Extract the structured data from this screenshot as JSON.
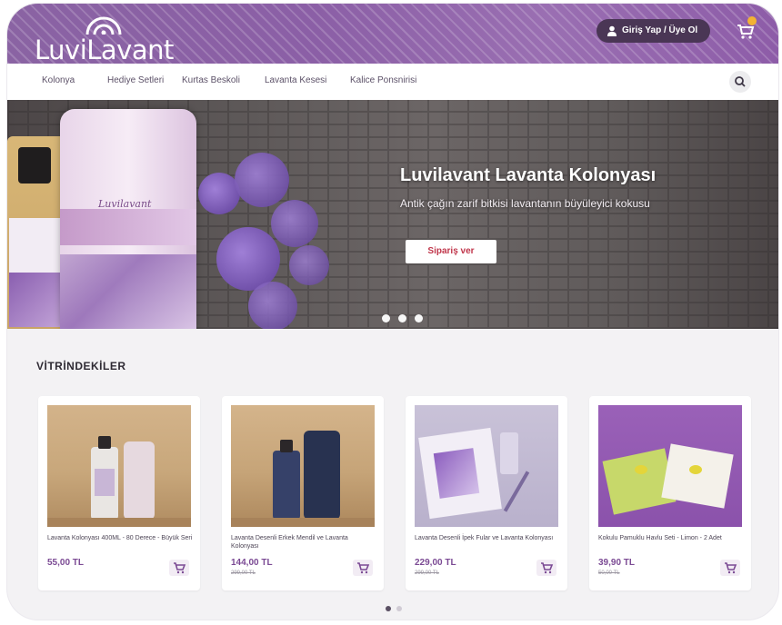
{
  "header": {
    "logo_text": "LuviLavant",
    "login_label": "Giriş Yap / Üye Ol",
    "cart_icon": "cart-icon",
    "user_icon": "user-icon"
  },
  "nav": {
    "items": [
      "Kolonya",
      "Hediye Setleri",
      "Kurtas Beskoli",
      "Lavanta Kesesi",
      "Kalice Ponsnirisi"
    ],
    "search_icon": "search-icon"
  },
  "hero": {
    "title": "Luvilavant Lavanta Kolonyası",
    "subtitle": "Antik çağın zarif bitkisi lavantanın büyüleyici kokusu",
    "cta_label": "Sipariş ver",
    "product_brand": "Luvilavant",
    "slides": 3
  },
  "showcase": {
    "title": "VİTRİNDEKİLER",
    "products": [
      {
        "name": "Lavanta Kolonyası 400ML - 80 Derece - Büyük Seri",
        "price": "55,00 TL",
        "old_price": ""
      },
      {
        "name": "Lavanta Desenli Erkek Mendil ve Lavanta Kolonyası",
        "price": "144,00 TL",
        "old_price": "299,00 TL"
      },
      {
        "name": "Lavanta Desenli İpek Fular ve Lavanta Kolonyası",
        "price": "229,00 TL",
        "old_price": "299,00 TL"
      },
      {
        "name": "Kokulu Pamuklu Havlu Seti - Limon - 2 Adet",
        "price": "39,90 TL",
        "old_price": "50,00 TL"
      }
    ],
    "pages": 2
  },
  "colors": {
    "brand": "#8a5fa6",
    "accent": "#7b4a94",
    "cta_text": "#c0364b",
    "badge": "#f2b233"
  }
}
